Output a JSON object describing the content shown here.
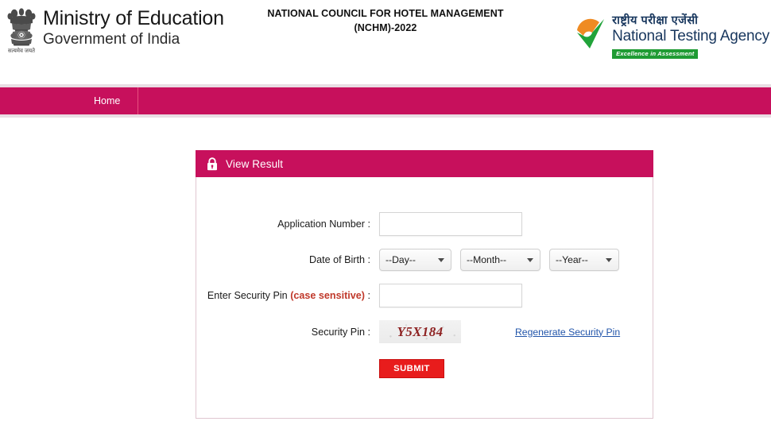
{
  "header": {
    "ministry_title": "Ministry of Education",
    "ministry_subtitle": "Government of India",
    "emblem_motto": "सत्यमेव जयते",
    "center_title_line1": "NATIONAL COUNCIL FOR HOTEL MANAGEMENT",
    "center_title_line2": "(NCHM)-2022",
    "nta_hindi": "राष्ट्रीय  परीक्षा  एजेंसी",
    "nta_english": "National Testing Agency",
    "nta_tagline": "Excellence in Assessment"
  },
  "nav": {
    "items": [
      {
        "label": "Home"
      }
    ]
  },
  "card": {
    "title": "View Result",
    "lock_icon": "lock-icon"
  },
  "form": {
    "application_number": {
      "label": "Application Number :",
      "value": "",
      "placeholder": ""
    },
    "date_of_birth": {
      "label": "Date of Birth :",
      "day": "--Day--",
      "month": "--Month--",
      "year": "--Year--"
    },
    "security_pin_input": {
      "label_main": "Enter Security Pin",
      "label_red": "(case sensitive)",
      "label_colon": ":",
      "value": "",
      "placeholder": ""
    },
    "security_pin_display": {
      "label": "Security Pin :",
      "captcha_text": "Y5X184",
      "regenerate_label": "Regenerate Security Pin"
    },
    "submit_label": "SUBMIT"
  },
  "colors": {
    "brand_magenta": "#c7105c",
    "submit_red": "#e81c1c",
    "link_blue": "#2255aa",
    "captcha_red": "#8e2222",
    "nta_blue": "#17365d",
    "nta_green": "#1f9b33",
    "alert_red": "#c0392b"
  }
}
